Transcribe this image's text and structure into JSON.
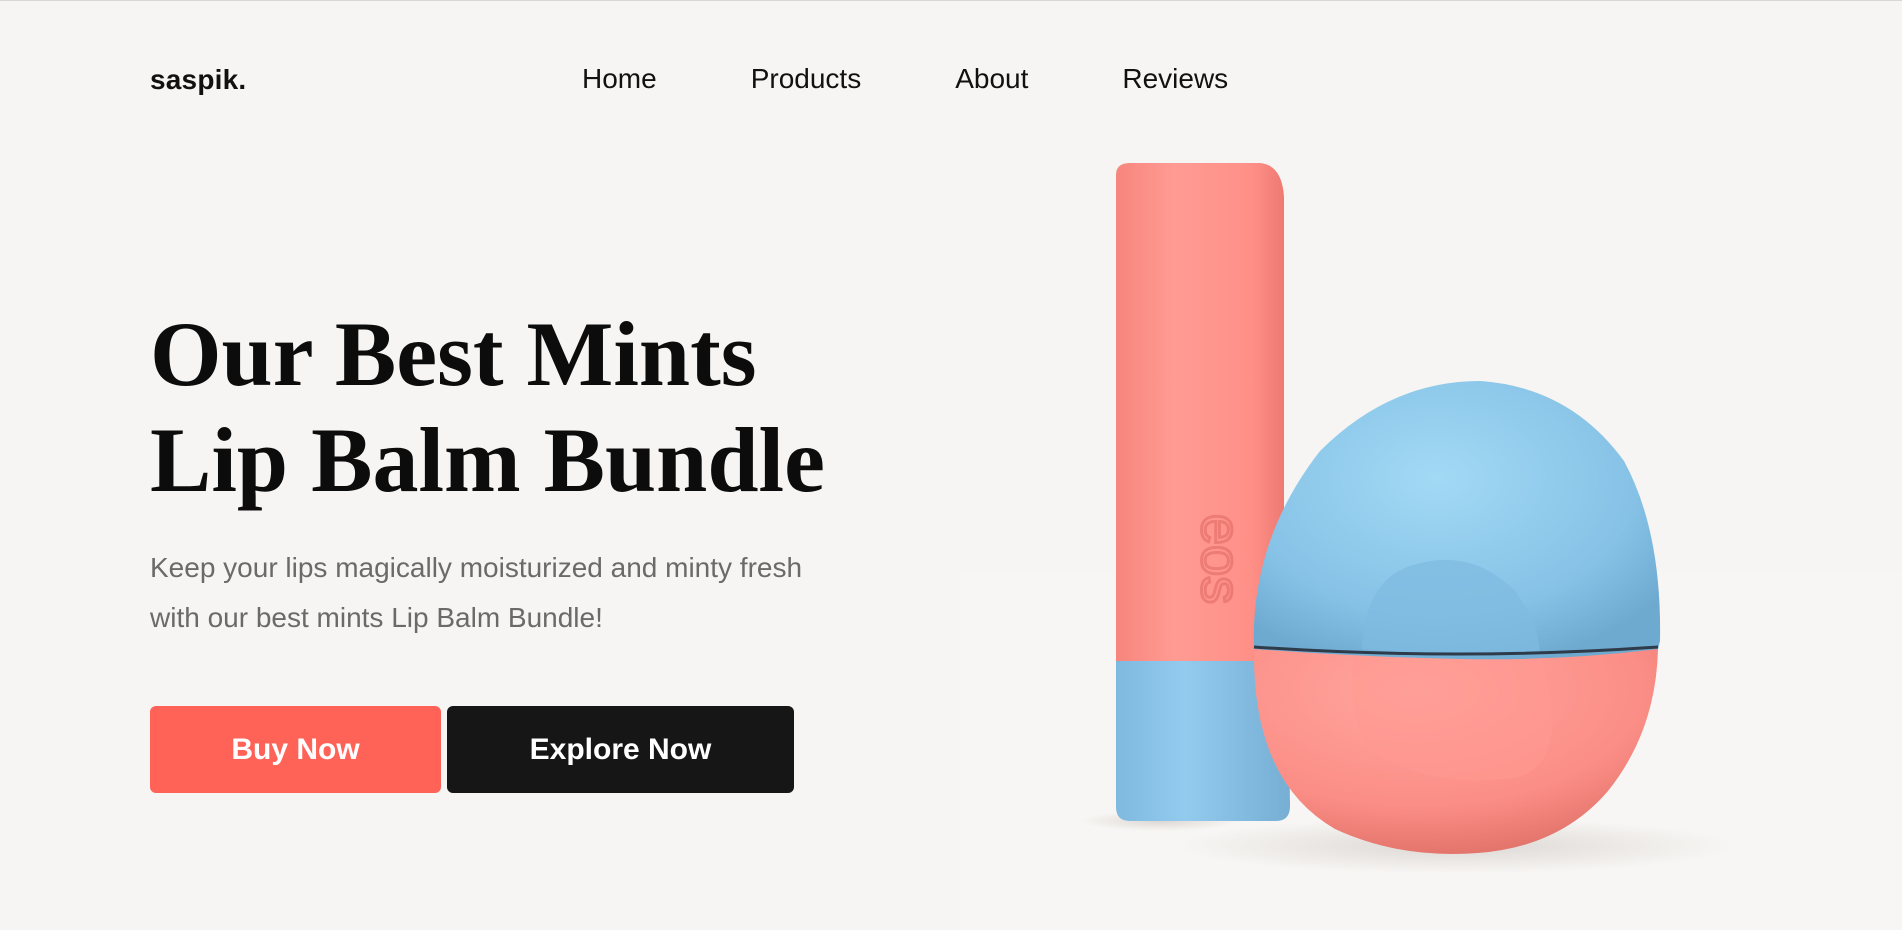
{
  "brand": {
    "name": "saspik."
  },
  "nav": {
    "items": [
      {
        "label": "Home"
      },
      {
        "label": "Products"
      },
      {
        "label": "About"
      },
      {
        "label": "Reviews"
      }
    ]
  },
  "hero": {
    "title_lines": [
      "Our Best Mints",
      "Lip Balm Bundle"
    ],
    "subtitle_lines": [
      "Keep your lips magically moisturized and minty fresh",
      "with our best mints Lip Balm Bundle!"
    ],
    "buy_label": "Buy Now",
    "explore_label": "Explore Now"
  },
  "product_image": {
    "stick_brand": "eos",
    "colors": {
      "coral": "#ff938c",
      "blue": "#88c4e8",
      "sphere_blue": "#8fcbea"
    }
  },
  "colors": {
    "background": "#f7f5f3",
    "accent": "#ff6257",
    "dark_button": "#161616",
    "subtitle_text": "#6a6a6a"
  }
}
